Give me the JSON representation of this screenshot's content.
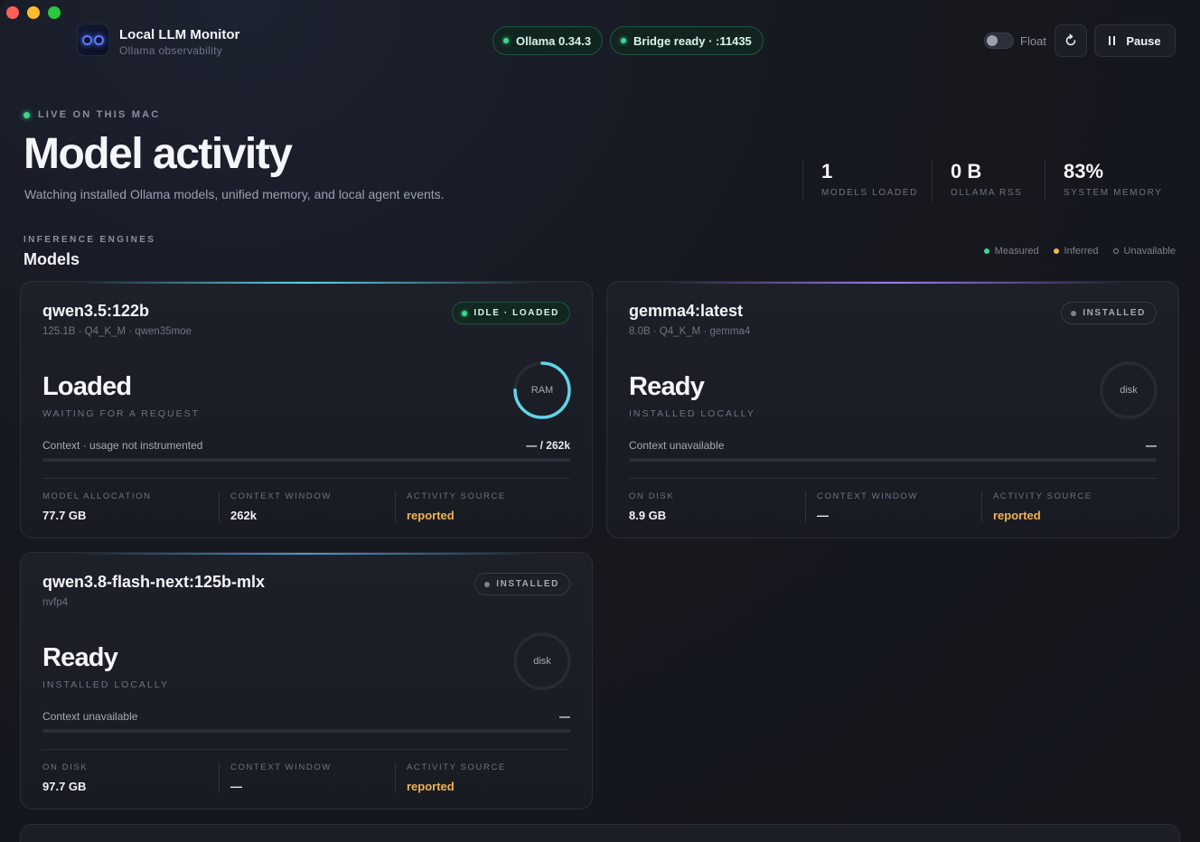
{
  "window": {
    "title": "Local LLM Monitor",
    "subtitle": "Ollama observability"
  },
  "header": {
    "status_pills": [
      {
        "label": "Ollama 0.34.3"
      },
      {
        "label": "Bridge ready · :11435"
      }
    ],
    "float_label": "Float",
    "refresh_icon": "refresh-icon",
    "pause_label": "Pause"
  },
  "hero": {
    "eyebrow": "LIVE ON THIS MAC",
    "title": "Model activity",
    "subtitle": "Watching installed Ollama models, unified memory, and local agent events.",
    "stats": [
      {
        "value": "1",
        "label": "MODELS LOADED"
      },
      {
        "value": "0 B",
        "label": "OLLAMA RSS"
      },
      {
        "value": "83%",
        "label": "SYSTEM MEMORY"
      }
    ]
  },
  "models_section": {
    "eyebrow": "INFERENCE ENGINES",
    "title": "Models",
    "legend": [
      {
        "label": "Measured",
        "color": "#3ed68e"
      },
      {
        "label": "Inferred",
        "color": "#f1b451"
      },
      {
        "label": "Unavailable",
        "color": "#8a909e"
      }
    ]
  },
  "cards": [
    {
      "name": "qwen3.5:122b",
      "meta": "125.1B · Q4_K_M · qwen35moe",
      "badge": "IDLE · LOADED",
      "state": "Loaded",
      "state_sub": "WAITING FOR A REQUEST",
      "ring_label": "RAM",
      "ring_fill": 0.75,
      "context_label": "Context · usage not instrumented",
      "context_value": "— / 262k",
      "col1_label": "MODEL ALLOCATION",
      "col1_value": "77.7 GB",
      "col2_label": "CONTEXT WINDOW",
      "col2_value": "262k",
      "col3_label": "ACTIVITY SOURCE",
      "col3_value": "reported",
      "accent": "#5fd4e8"
    },
    {
      "name": "gemma4:latest",
      "meta": "8.0B · Q4_K_M · gemma4",
      "badge": "INSTALLED",
      "state": "Ready",
      "state_sub": "INSTALLED LOCALLY",
      "ring_label": "disk",
      "context_label": "Context unavailable",
      "context_value": "—",
      "col1_label": "ON DISK",
      "col1_value": "8.9 GB",
      "col2_label": "CONTEXT WINDOW",
      "col2_value": "—",
      "col3_label": "ACTIVITY SOURCE",
      "col3_value": "reported",
      "accent": "#9b7cf0"
    },
    {
      "name": "qwen3.8-flash-next:125b-mlx",
      "meta": "nvfp4",
      "badge": "INSTALLED",
      "state": "Ready",
      "state_sub": "INSTALLED LOCALLY",
      "ring_label": "disk",
      "context_label": "Context unavailable",
      "context_value": "—",
      "col1_label": "ON DISK",
      "col1_value": "97.7 GB",
      "col2_label": "CONTEXT WINDOW",
      "col2_value": "—",
      "col3_label": "ACTIVITY SOURCE",
      "col3_value": "reported",
      "accent": "#4a9cc8"
    }
  ]
}
